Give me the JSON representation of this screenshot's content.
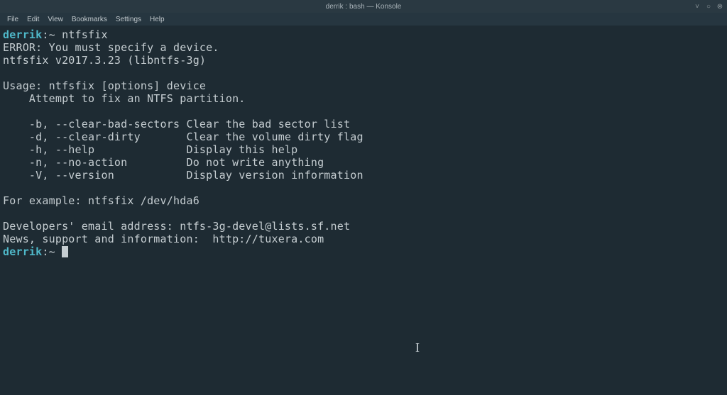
{
  "window": {
    "title": "derrik : bash — Konsole"
  },
  "menu": {
    "file": "File",
    "edit": "Edit",
    "view": "View",
    "bookmarks": "Bookmarks",
    "settings": "Settings",
    "help": "Help"
  },
  "terminal": {
    "prompt_user": "derrik",
    "prompt_sep": ":",
    "prompt_path": "~",
    "command1": "ntfsfix",
    "line_error": "ERROR: You must specify a device.",
    "line_version": "ntfsfix v2017.3.23 (libntfs-3g)",
    "line_usage": "Usage: ntfsfix [options] device",
    "line_desc": "    Attempt to fix an NTFS partition.",
    "opt_b": "    -b, --clear-bad-sectors Clear the bad sector list",
    "opt_d": "    -d, --clear-dirty       Clear the volume dirty flag",
    "opt_h": "    -h, --help              Display this help",
    "opt_n": "    -n, --no-action         Do not write anything",
    "opt_v": "    -V, --version           Display version information",
    "line_example": "For example: ntfsfix /dev/hda6",
    "line_dev": "Developers' email address: ntfs-3g-devel@lists.sf.net",
    "line_news": "News, support and information:  http://tuxera.com"
  }
}
